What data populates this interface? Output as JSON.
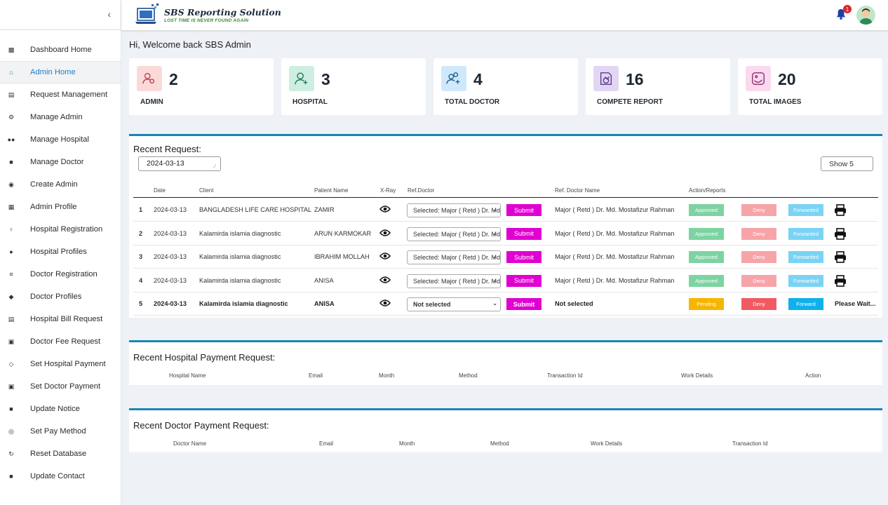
{
  "app": {
    "title": "SBS Reporting Solution",
    "tagline": "LOST TIME IS NEVER FOUND AGAIN",
    "notification_count": "1"
  },
  "sidebar": {
    "items": [
      {
        "label": "Dashboard Home",
        "icon": "dashboard-icon",
        "active": false
      },
      {
        "label": "Admin Home",
        "icon": "home-icon",
        "active": true
      },
      {
        "label": "Request Management",
        "icon": "document-icon",
        "active": false
      },
      {
        "label": "Manage Admin",
        "icon": "admin-icon",
        "active": false
      },
      {
        "label": "Manage Hospital",
        "icon": "users-icon",
        "active": false
      },
      {
        "label": "Manage Doctor",
        "icon": "doctor-icon",
        "active": false
      },
      {
        "label": "Create Admin",
        "icon": "user-cog-icon",
        "active": false
      },
      {
        "label": "Admin Profile",
        "icon": "profile-card-icon",
        "active": false
      },
      {
        "label": "Hospital Registration",
        "icon": "user-plus-icon",
        "active": false
      },
      {
        "label": "Hospital Profiles",
        "icon": "user-group-icon",
        "active": false
      },
      {
        "label": "Doctor Registration",
        "icon": "list-icon",
        "active": false
      },
      {
        "label": "Doctor Profiles",
        "icon": "shield-icon",
        "active": false
      },
      {
        "label": "Hospital Bill Request",
        "icon": "card-icon",
        "active": false
      },
      {
        "label": "Doctor Fee Request",
        "icon": "money-icon",
        "active": false
      },
      {
        "label": "Set Hospital Payment",
        "icon": "tag-icon",
        "active": false
      },
      {
        "label": "Set Doctor Payment",
        "icon": "wallet-icon",
        "active": false
      },
      {
        "label": "Update Notice",
        "icon": "message-icon",
        "active": false
      },
      {
        "label": "Set Pay Method",
        "icon": "coin-icon",
        "active": false
      },
      {
        "label": "Reset Database",
        "icon": "reset-icon",
        "active": false
      },
      {
        "label": "Update Contact",
        "icon": "contact-icon",
        "active": false
      }
    ]
  },
  "main": {
    "welcome": "Hi, Welcome back SBS Admin",
    "stats": [
      {
        "value": "2",
        "label": "ADMIN",
        "icon": "user-cog-icon",
        "color": "#fcd9d9",
        "stroke": "#b0454a"
      },
      {
        "value": "3",
        "label": "HOSPITAL",
        "icon": "user-plus-icon",
        "color": "#cdeee0",
        "stroke": "#1f7a5a"
      },
      {
        "value": "4",
        "label": "TOTAL DOCTOR",
        "icon": "users-plus-icon",
        "color": "#cfe8fb",
        "stroke": "#1f5f8f"
      },
      {
        "value": "16",
        "label": "COMPETE REPORT",
        "icon": "report-icon",
        "color": "#e3d6f5",
        "stroke": "#5c3d8f"
      },
      {
        "value": "20",
        "label": "TOTAL IMAGES",
        "icon": "image-icon",
        "color": "#fbd9ef",
        "stroke": "#8f2b6e"
      }
    ]
  },
  "recent_request": {
    "title": "Recent Request:",
    "date": "2024-03-13",
    "show": "Show 5",
    "columns": [
      "Date",
      "Client",
      "Patient Name",
      "X-Ray",
      "Ref.Doctor",
      "Ref. Doctor Name",
      "Action/Reports"
    ],
    "rows": [
      {
        "num": "1",
        "date": "2024-03-13",
        "client": "BANGLADESH LIFE CARE HOSPITAL",
        "patient": "ZAMIR",
        "ref_select": "Selected: Major ( Retd ) Dr. Md. Mostafizur Rahman",
        "submit": "Submit",
        "ref_name": "Major ( Retd ) Dr. Md. Mostafizur Rahman",
        "status": "Approved",
        "deny": "Deny",
        "forward": "Forwarded",
        "tail": "print"
      },
      {
        "num": "2",
        "date": "2024-03-13",
        "client": "Kalamirda islamia diagnostic",
        "patient": "ARUN KARMOKAR",
        "ref_select": "Selected: Major ( Retd ) Dr. Md. Mostafizur Rahman",
        "submit": "Submit",
        "ref_name": "Major ( Retd ) Dr. Md. Mostafizur Rahman",
        "status": "Approved",
        "deny": "Deny",
        "forward": "Forwarded",
        "tail": "print"
      },
      {
        "num": "3",
        "date": "2024-03-13",
        "client": "Kalamirda islamia diagnostic",
        "patient": "IBRAHIM MOLLAH",
        "ref_select": "Selected: Major ( Retd ) Dr. Md. Mostafizur Rahman",
        "submit": "Submit",
        "ref_name": "Major ( Retd ) Dr. Md. Mostafizur Rahman",
        "status": "Approved",
        "deny": "Deny",
        "forward": "Forwarded",
        "tail": "print"
      },
      {
        "num": "4",
        "date": "2024-03-13",
        "client": "Kalamirda islamia diagnostic",
        "patient": "ANISA",
        "ref_select": "Selected: Major ( Retd ) Dr. Md. Mostafizur Rahman",
        "submit": "Submit",
        "ref_name": "Major ( Retd ) Dr. Md. Mostafizur Rahman",
        "status": "Approved",
        "deny": "Deny",
        "forward": "Forwarded",
        "tail": "print"
      },
      {
        "num": "5",
        "date": "2024-03-13",
        "client": "Kalamirda islamia diagnostic",
        "patient": "ANISA",
        "ref_select": "Not selected",
        "submit": "Submit",
        "ref_name": "Not selected",
        "status": "Pending",
        "deny": "Deny",
        "forward": "Forward",
        "tail": "Please Wait..."
      }
    ]
  },
  "hospital_payment": {
    "title": "Recent Hospital Payment Request:",
    "columns": [
      "Hospital Name",
      "Email",
      "Month",
      "Method",
      "Transaction Id",
      "Work Details",
      "Action"
    ]
  },
  "doctor_payment": {
    "title": "Recent Doctor Payment Request:",
    "columns": [
      "Doctor Name",
      "Email",
      "Month",
      "Method",
      "Work Details",
      "Transaction Id"
    ]
  },
  "colors": {
    "accent": "#1c84b4",
    "submit": "#e000d0",
    "approved": "#6fcf97",
    "pending": "#f7b500",
    "deny": "#f25a63",
    "forward": "#0fb0ec"
  }
}
